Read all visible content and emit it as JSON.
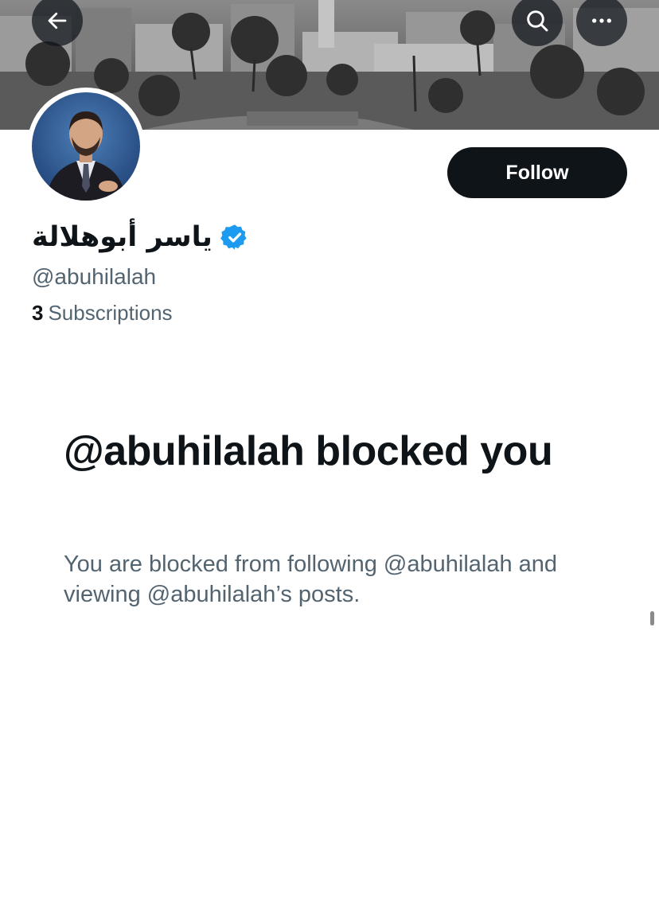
{
  "profile": {
    "display_name": "ياسر أبوهلالة",
    "handle": "@abuhilalah",
    "subscriptions_count": "3",
    "subscriptions_label": "Subscriptions",
    "verified": true
  },
  "actions": {
    "follow_label": "Follow"
  },
  "blocked": {
    "title": "@abuhilalah blocked you",
    "description": "You are blocked from following @abuhilalah and viewing @abuhilalah’s posts."
  },
  "icons": {
    "back": "arrow-left-icon",
    "search": "search-icon",
    "more": "more-horizontal-icon",
    "verified": "verified-badge-icon"
  },
  "colors": {
    "primary_text": "#0f1419",
    "secondary_text": "#536471",
    "verified_blue": "#1d9bf0",
    "button_bg": "#0f1419"
  }
}
